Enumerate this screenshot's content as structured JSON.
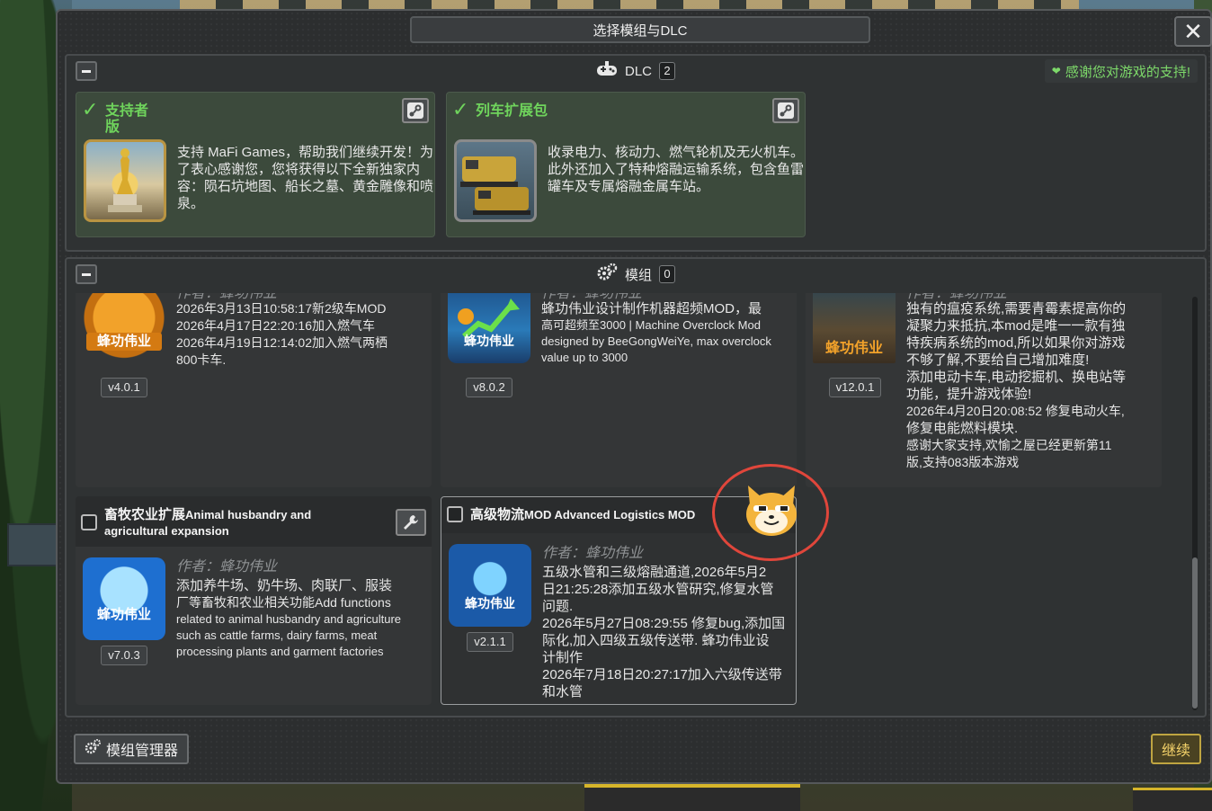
{
  "window": {
    "title": "选择模组与DLC",
    "close_label": "✕"
  },
  "dlc_section": {
    "label": "DLC",
    "count": "2",
    "thanks": "感谢您对游戏的支持!",
    "cards": [
      {
        "name": "支持者版",
        "desc": "支持 MaFi Games，帮助我们继续开发！为了表心感谢您，您将获得以下全新独家内容：陨石坑地图、船长之墓、黄金雕像和喷泉。"
      },
      {
        "name": "列车扩展包",
        "desc": "收录电力、核动力、燃气轮机及无火机车。此外还加入了特种熔融运输系统，包含鱼雷罐车及专属熔融金属车站。"
      }
    ]
  },
  "mods_section": {
    "label": "模组",
    "count": "0",
    "author_label": "作者：",
    "author_name": "蜂功伟业",
    "icon_text": "蜂功伟业",
    "mods": [
      {
        "version": "v4.0.1",
        "desc": [
          "2026年3月13日10:58:17新2级车MOD",
          "2026年4月17日22:20:16加入燃气车",
          "2026年4月19日12:14:02加入燃气两栖",
          "800卡车."
        ]
      },
      {
        "version": "v8.0.2",
        "desc": [
          "蜂功伟业设计制作机器超频MOD，最",
          "高可超频至3000 | Machine Overclock Mod",
          "designed by BeeGongWeiYe, max overclock",
          "value up to 3000"
        ]
      },
      {
        "version": "v12.0.1",
        "desc": [
          "独有的瘟疫系统,需要青霉素提高你的",
          "凝聚力来抵抗,本mod是唯一一款有独",
          "特疾病系统的mod,所以如果你对游戏",
          "不够了解,不要给自己增加难度!",
          "添加电动卡车,电动挖掘机、换电站等",
          "功能，提升游戏体验!",
          "2026年4月20日20:08:52 修复电动火车,",
          "修复电能燃料模块.",
          "感谢大家支持,欢愉之屋已经更新第11",
          "版,支持083版本游戏"
        ]
      },
      {
        "title": "畜牧农业扩展",
        "title_en": "Animal husbandry and",
        "title_en2": "agricultural expansion",
        "version": "v7.0.3",
        "desc": [
          "添加养牛场、奶牛场、肉联厂、服装",
          "厂等畜牧和农业相关功能Add functions",
          "related to animal husbandry and agriculture",
          "such as cattle farms, dairy farms, meat",
          "processing plants and garment factories"
        ]
      },
      {
        "title": "高级物流",
        "title_en": "MOD Advanced Logistics MOD",
        "version": "v2.1.1",
        "desc": [
          "五级水管和三级熔融通道,2026年5月2",
          "日21:25:28添加五级水管研究,修复水管",
          "问题.",
          "2026年5月27日08:29:55 修复bug,添加国",
          "际化,加入四级五级传送带. 蜂功伟业设",
          "计制作",
          "2026年7月18日20:27:17加入六级传送带",
          "和水管"
        ]
      }
    ]
  },
  "footer": {
    "mod_manager": "模组管理器",
    "continue": "继续"
  },
  "colors": {
    "accent_green": "#6fd45c",
    "gold": "#bfa541",
    "highlight_red": "#e0463b"
  }
}
